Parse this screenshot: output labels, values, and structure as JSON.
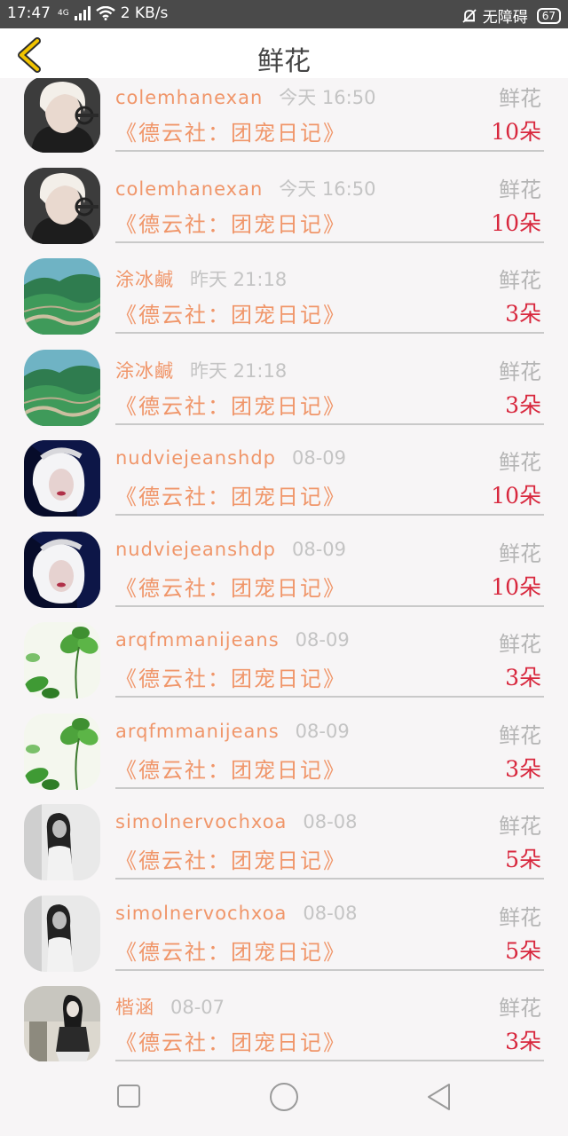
{
  "status_bar": {
    "time": "17:47",
    "network": "4G",
    "speed": "2 KB/s",
    "accessibility": "无障碍",
    "battery": "67"
  },
  "header": {
    "title": "鲜花"
  },
  "items": [
    {
      "name": "colemhanexan",
      "time": "今天 16:50",
      "type": "鲜花",
      "book": "《德云社：团宠日记》",
      "amount": "10朵",
      "avatar": "blond-man"
    },
    {
      "name": "colemhanexan",
      "time": "今天 16:50",
      "type": "鲜花",
      "book": "《德云社：团宠日记》",
      "amount": "10朵",
      "avatar": "blond-man"
    },
    {
      "name": "涂冰鹹",
      "time": "昨天 21:18",
      "type": "鲜花",
      "book": "《德云社：团宠日记》",
      "amount": "3朵",
      "avatar": "great-wall"
    },
    {
      "name": "涂冰鹹",
      "time": "昨天 21:18",
      "type": "鲜花",
      "book": "《德云社：团宠日记》",
      "amount": "3朵",
      "avatar": "great-wall"
    },
    {
      "name": "nudviejeanshdp",
      "time": "08-09",
      "type": "鲜花",
      "book": "《德云社：团宠日记》",
      "amount": "10朵",
      "avatar": "white-hair"
    },
    {
      "name": "nudviejeanshdp",
      "time": "08-09",
      "type": "鲜花",
      "book": "《德云社：团宠日记》",
      "amount": "10朵",
      "avatar": "white-hair"
    },
    {
      "name": "arqfmmanijeans",
      "time": "08-09",
      "type": "鲜花",
      "book": "《德云社：团宠日记》",
      "amount": "3朵",
      "avatar": "clover"
    },
    {
      "name": "arqfmmanijeans",
      "time": "08-09",
      "type": "鲜花",
      "book": "《德云社：团宠日记》",
      "amount": "3朵",
      "avatar": "clover"
    },
    {
      "name": "simolnervochxoa",
      "time": "08-08",
      "type": "鲜花",
      "book": "《德云社：团宠日记》",
      "amount": "5朵",
      "avatar": "bw-girl"
    },
    {
      "name": "simolnervochxoa",
      "time": "08-08",
      "type": "鲜花",
      "book": "《德云社：团宠日记》",
      "amount": "5朵",
      "avatar": "bw-girl"
    },
    {
      "name": "楷涵",
      "time": "08-07",
      "type": "鲜花",
      "book": "《德云社：团宠日记》",
      "amount": "3朵",
      "avatar": "girl-outdoor"
    }
  ],
  "colors": {
    "name": "#f0966a",
    "time": "#c4c4c4",
    "amount": "#d8283e",
    "back_icon": "#f2c400"
  },
  "nav_bar": {
    "buttons": [
      "square-icon",
      "circle-icon",
      "triangle-back-icon"
    ]
  }
}
